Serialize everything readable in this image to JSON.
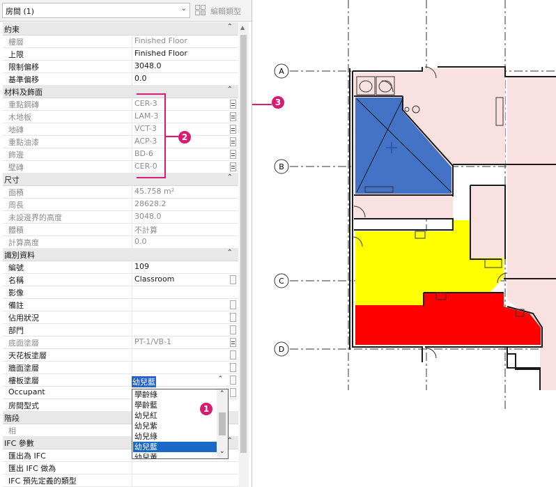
{
  "panel": {
    "type_selector": "房間 (1)",
    "edit_type": "編輯類型"
  },
  "sections": {
    "constraints": "約束",
    "materials": "材料及飾面",
    "dimensions": "尺寸",
    "identity": "識別資料",
    "phasing": "階段",
    "ifc": "IFC 參數"
  },
  "rows": {
    "level": {
      "label": "樓層",
      "value": "Finished Floor"
    },
    "upper_limit": {
      "label": "上限",
      "value": "Finished Floor"
    },
    "limit_offset": {
      "label": "限制偏移",
      "value": "3048.0"
    },
    "base_offset": {
      "label": "基準偏移",
      "value": "0.0"
    },
    "accent_wall": {
      "label": "重點鋼磚",
      "value": "CER-3"
    },
    "wood_floor": {
      "label": "木地板",
      "value": "LAM-3"
    },
    "floor_tile": {
      "label": "地磚",
      "value": "VCT-3"
    },
    "accent_paint": {
      "label": "重點油漆",
      "value": "ACP-3"
    },
    "trim": {
      "label": "飾邊",
      "value": "BD-6"
    },
    "wall_tile": {
      "label": "壁磚",
      "value": "CER-0"
    },
    "area": {
      "label": "面積",
      "value": "45.758 m²"
    },
    "perimeter": {
      "label": "周長",
      "value": "28628.2"
    },
    "unbound_height": {
      "label": "未設邊界的高度",
      "value": "3048.0"
    },
    "volume": {
      "label": "體積",
      "value": "不計算"
    },
    "compute_height": {
      "label": "計算高度",
      "value": "0.0"
    },
    "number": {
      "label": "編號",
      "value": "109"
    },
    "name": {
      "label": "名稱",
      "value": "Classroom"
    },
    "image": {
      "label": "影像",
      "value": ""
    },
    "comments": {
      "label": "備註",
      "value": ""
    },
    "occupancy": {
      "label": "佔用狀況",
      "value": ""
    },
    "department": {
      "label": "部門",
      "value": ""
    },
    "base_finish": {
      "label": "底面塗層",
      "value": "PT-1/VB-1"
    },
    "ceiling_finish": {
      "label": "天花板塗層",
      "value": ""
    },
    "wall_finish": {
      "label": "牆面塗層",
      "value": ""
    },
    "floor_finish": {
      "label": "樓板塗層",
      "value": ""
    },
    "occupant": {
      "label": "Occupant",
      "value": ""
    },
    "room_style": {
      "label": "房間型式",
      "value": "幼兒藍"
    },
    "phase_row": {
      "label": "相",
      "value": ""
    },
    "export_ifc": {
      "label": "匯出為 IFC",
      "value": ""
    },
    "export_ifc_as": {
      "label": "匯出 IFC 做為",
      "value": ""
    },
    "ifc_predefined": {
      "label": "IFC 預先定義的類型",
      "value": ""
    }
  },
  "dropdown": {
    "options": [
      "學齡綠",
      "學齡藍",
      "幼兒紅",
      "幼兒紫",
      "幼兒綠",
      "幼兒藍",
      "幼兒黃"
    ],
    "selected": "幼兒藍"
  },
  "callouts": [
    "1",
    "2",
    "3"
  ],
  "grid_bubbles": [
    "A",
    "B",
    "C",
    "D"
  ],
  "colors": {
    "callout": "#d81b72",
    "room_blue": "#4472c4",
    "room_yellow": "#ffff00",
    "room_red": "#ff0000",
    "room_pink": "#f9e1e1",
    "selection": "#1b69c7"
  }
}
